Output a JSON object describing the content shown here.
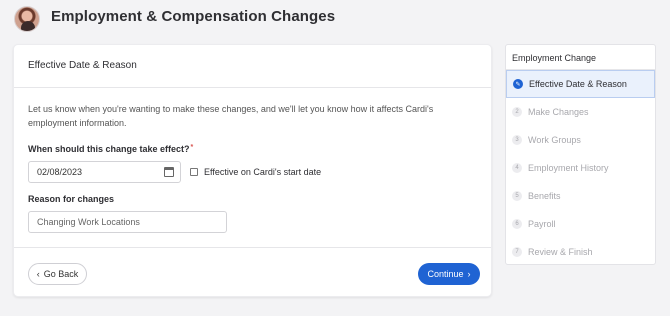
{
  "header": {
    "title": "Employment & Compensation Changes",
    "avatar_icon": "user-avatar"
  },
  "form": {
    "section_title": "Effective Date & Reason",
    "intro": "Let us know when you're wanting to make these changes, and we'll let you know how it affects Cardi's employment information.",
    "date_question": "When should this change take effect?",
    "date_value": "02/08/2023",
    "checkbox_label": "Effective on Cardi's start date",
    "reason_label": "Reason for changes",
    "reason_value": "Changing Work Locations",
    "back_label": "Go Back",
    "continue_label": "Continue"
  },
  "steps": {
    "title": "Employment Change",
    "items": [
      {
        "num": "",
        "label": "Effective Date & Reason",
        "active": true
      },
      {
        "num": "2",
        "label": "Make Changes"
      },
      {
        "num": "3",
        "label": "Work Groups"
      },
      {
        "num": "4",
        "label": "Employment History"
      },
      {
        "num": "5",
        "label": "Benefits"
      },
      {
        "num": "6",
        "label": "Payroll"
      },
      {
        "num": "7",
        "label": "Review & Finish"
      }
    ]
  },
  "colors": {
    "accent": "#1f63d3",
    "background": "#f3f3f5",
    "required": "#d9534f"
  }
}
